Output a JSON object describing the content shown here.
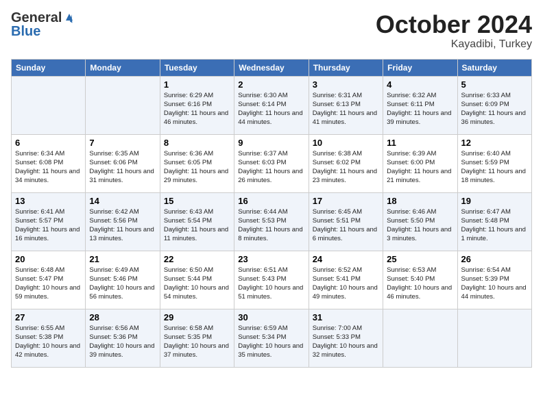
{
  "header": {
    "logo_general": "General",
    "logo_blue": "Blue",
    "month": "October 2024",
    "location": "Kayadibi, Turkey"
  },
  "days_of_week": [
    "Sunday",
    "Monday",
    "Tuesday",
    "Wednesday",
    "Thursday",
    "Friday",
    "Saturday"
  ],
  "weeks": [
    [
      {
        "day": "",
        "info": ""
      },
      {
        "day": "",
        "info": ""
      },
      {
        "day": "1",
        "info": "Sunrise: 6:29 AM\nSunset: 6:16 PM\nDaylight: 11 hours and 46 minutes."
      },
      {
        "day": "2",
        "info": "Sunrise: 6:30 AM\nSunset: 6:14 PM\nDaylight: 11 hours and 44 minutes."
      },
      {
        "day": "3",
        "info": "Sunrise: 6:31 AM\nSunset: 6:13 PM\nDaylight: 11 hours and 41 minutes."
      },
      {
        "day": "4",
        "info": "Sunrise: 6:32 AM\nSunset: 6:11 PM\nDaylight: 11 hours and 39 minutes."
      },
      {
        "day": "5",
        "info": "Sunrise: 6:33 AM\nSunset: 6:09 PM\nDaylight: 11 hours and 36 minutes."
      }
    ],
    [
      {
        "day": "6",
        "info": "Sunrise: 6:34 AM\nSunset: 6:08 PM\nDaylight: 11 hours and 34 minutes."
      },
      {
        "day": "7",
        "info": "Sunrise: 6:35 AM\nSunset: 6:06 PM\nDaylight: 11 hours and 31 minutes."
      },
      {
        "day": "8",
        "info": "Sunrise: 6:36 AM\nSunset: 6:05 PM\nDaylight: 11 hours and 29 minutes."
      },
      {
        "day": "9",
        "info": "Sunrise: 6:37 AM\nSunset: 6:03 PM\nDaylight: 11 hours and 26 minutes."
      },
      {
        "day": "10",
        "info": "Sunrise: 6:38 AM\nSunset: 6:02 PM\nDaylight: 11 hours and 23 minutes."
      },
      {
        "day": "11",
        "info": "Sunrise: 6:39 AM\nSunset: 6:00 PM\nDaylight: 11 hours and 21 minutes."
      },
      {
        "day": "12",
        "info": "Sunrise: 6:40 AM\nSunset: 5:59 PM\nDaylight: 11 hours and 18 minutes."
      }
    ],
    [
      {
        "day": "13",
        "info": "Sunrise: 6:41 AM\nSunset: 5:57 PM\nDaylight: 11 hours and 16 minutes."
      },
      {
        "day": "14",
        "info": "Sunrise: 6:42 AM\nSunset: 5:56 PM\nDaylight: 11 hours and 13 minutes."
      },
      {
        "day": "15",
        "info": "Sunrise: 6:43 AM\nSunset: 5:54 PM\nDaylight: 11 hours and 11 minutes."
      },
      {
        "day": "16",
        "info": "Sunrise: 6:44 AM\nSunset: 5:53 PM\nDaylight: 11 hours and 8 minutes."
      },
      {
        "day": "17",
        "info": "Sunrise: 6:45 AM\nSunset: 5:51 PM\nDaylight: 11 hours and 6 minutes."
      },
      {
        "day": "18",
        "info": "Sunrise: 6:46 AM\nSunset: 5:50 PM\nDaylight: 11 hours and 3 minutes."
      },
      {
        "day": "19",
        "info": "Sunrise: 6:47 AM\nSunset: 5:48 PM\nDaylight: 11 hours and 1 minute."
      }
    ],
    [
      {
        "day": "20",
        "info": "Sunrise: 6:48 AM\nSunset: 5:47 PM\nDaylight: 10 hours and 59 minutes."
      },
      {
        "day": "21",
        "info": "Sunrise: 6:49 AM\nSunset: 5:46 PM\nDaylight: 10 hours and 56 minutes."
      },
      {
        "day": "22",
        "info": "Sunrise: 6:50 AM\nSunset: 5:44 PM\nDaylight: 10 hours and 54 minutes."
      },
      {
        "day": "23",
        "info": "Sunrise: 6:51 AM\nSunset: 5:43 PM\nDaylight: 10 hours and 51 minutes."
      },
      {
        "day": "24",
        "info": "Sunrise: 6:52 AM\nSunset: 5:41 PM\nDaylight: 10 hours and 49 minutes."
      },
      {
        "day": "25",
        "info": "Sunrise: 6:53 AM\nSunset: 5:40 PM\nDaylight: 10 hours and 46 minutes."
      },
      {
        "day": "26",
        "info": "Sunrise: 6:54 AM\nSunset: 5:39 PM\nDaylight: 10 hours and 44 minutes."
      }
    ],
    [
      {
        "day": "27",
        "info": "Sunrise: 6:55 AM\nSunset: 5:38 PM\nDaylight: 10 hours and 42 minutes."
      },
      {
        "day": "28",
        "info": "Sunrise: 6:56 AM\nSunset: 5:36 PM\nDaylight: 10 hours and 39 minutes."
      },
      {
        "day": "29",
        "info": "Sunrise: 6:58 AM\nSunset: 5:35 PM\nDaylight: 10 hours and 37 minutes."
      },
      {
        "day": "30",
        "info": "Sunrise: 6:59 AM\nSunset: 5:34 PM\nDaylight: 10 hours and 35 minutes."
      },
      {
        "day": "31",
        "info": "Sunrise: 7:00 AM\nSunset: 5:33 PM\nDaylight: 10 hours and 32 minutes."
      },
      {
        "day": "",
        "info": ""
      },
      {
        "day": "",
        "info": ""
      }
    ]
  ]
}
